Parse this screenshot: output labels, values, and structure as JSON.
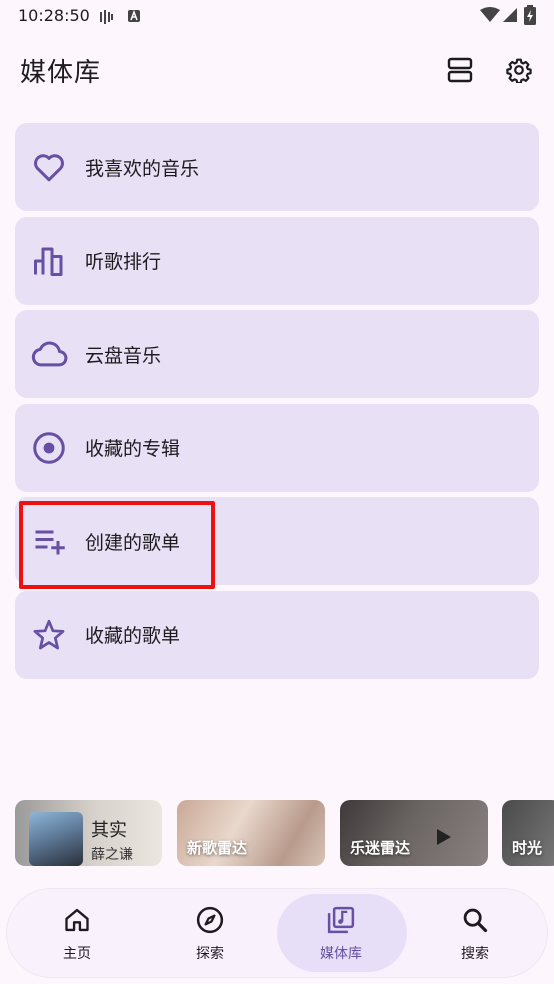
{
  "status_bar": {
    "time": "10:28:50"
  },
  "header": {
    "title": "媒体库",
    "layout_icon": "view-agenda-icon",
    "settings_icon": "gear-icon"
  },
  "library": {
    "items": [
      {
        "label": "我喜欢的音乐",
        "icon": "heart-icon"
      },
      {
        "label": "听歌排行",
        "icon": "bar-chart-icon"
      },
      {
        "label": "云盘音乐",
        "icon": "cloud-icon"
      },
      {
        "label": "收藏的专辑",
        "icon": "album-disc-icon"
      },
      {
        "label": "创建的歌单",
        "icon": "playlist-add-icon"
      },
      {
        "label": "收藏的歌单",
        "icon": "star-icon"
      }
    ]
  },
  "recommendations": {
    "now_playing": {
      "title": "其实",
      "artist": "薛之谦"
    },
    "cards": [
      {
        "label": "新歌雷达"
      },
      {
        "label": "乐迷雷达"
      },
      {
        "label": "时光"
      }
    ]
  },
  "bottom_nav": {
    "items": [
      {
        "label": "主页",
        "icon": "home-icon"
      },
      {
        "label": "探索",
        "icon": "compass-icon"
      },
      {
        "label": "媒体库",
        "icon": "music-library-icon",
        "active": true
      },
      {
        "label": "搜索",
        "icon": "search-icon"
      }
    ]
  },
  "colors": {
    "accent": "#6750a4",
    "card": "#e8e0f5",
    "highlight": "#ee1111"
  }
}
